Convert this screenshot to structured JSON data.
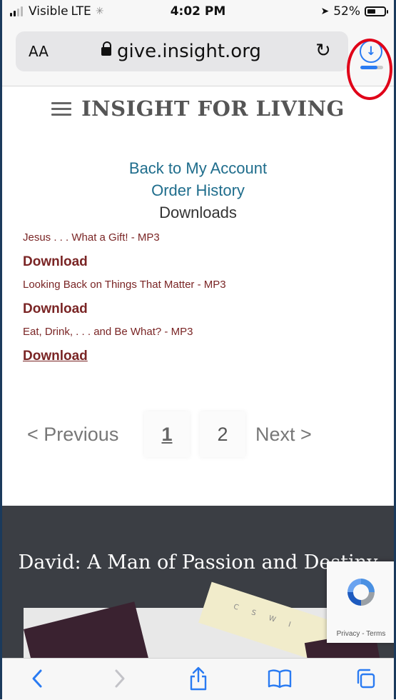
{
  "status_bar": {
    "carrier": "Visible",
    "network": "LTE",
    "time": "4:02 PM",
    "battery": "52%",
    "battery_level": 0.52
  },
  "browser": {
    "text_size_label": "AA",
    "url": "give.insight.org",
    "download_progress": 0.75,
    "accent_color": "#2a7bf2",
    "highlight_color": "#e00018"
  },
  "site": {
    "title": "INSIGHT FOR LIVING"
  },
  "account_nav": {
    "back_link": "Back to My Account",
    "order_history": "Order History",
    "downloads": "Downloads"
  },
  "downloads": [
    {
      "name": "Jesus . . . What a Gift! - MP3",
      "link": "Download"
    },
    {
      "name": "Looking Back on Things That Matter - MP3",
      "link": "Download"
    },
    {
      "name": "Eat, Drink, . . . and Be What? - MP3",
      "link": "Download"
    }
  ],
  "pagination": {
    "previous": "< Previous",
    "pages": [
      "1",
      "2"
    ],
    "current_page": "1",
    "next": "Next >"
  },
  "feature": {
    "title": "David: A Man of Passion and Destiny"
  },
  "recaptcha": {
    "terms": "Privacy - Terms"
  },
  "toolbar": {
    "icons": [
      "back-arrow-icon",
      "forward-arrow-icon",
      "share-icon",
      "bookmarks-icon",
      "tabs-icon"
    ]
  }
}
